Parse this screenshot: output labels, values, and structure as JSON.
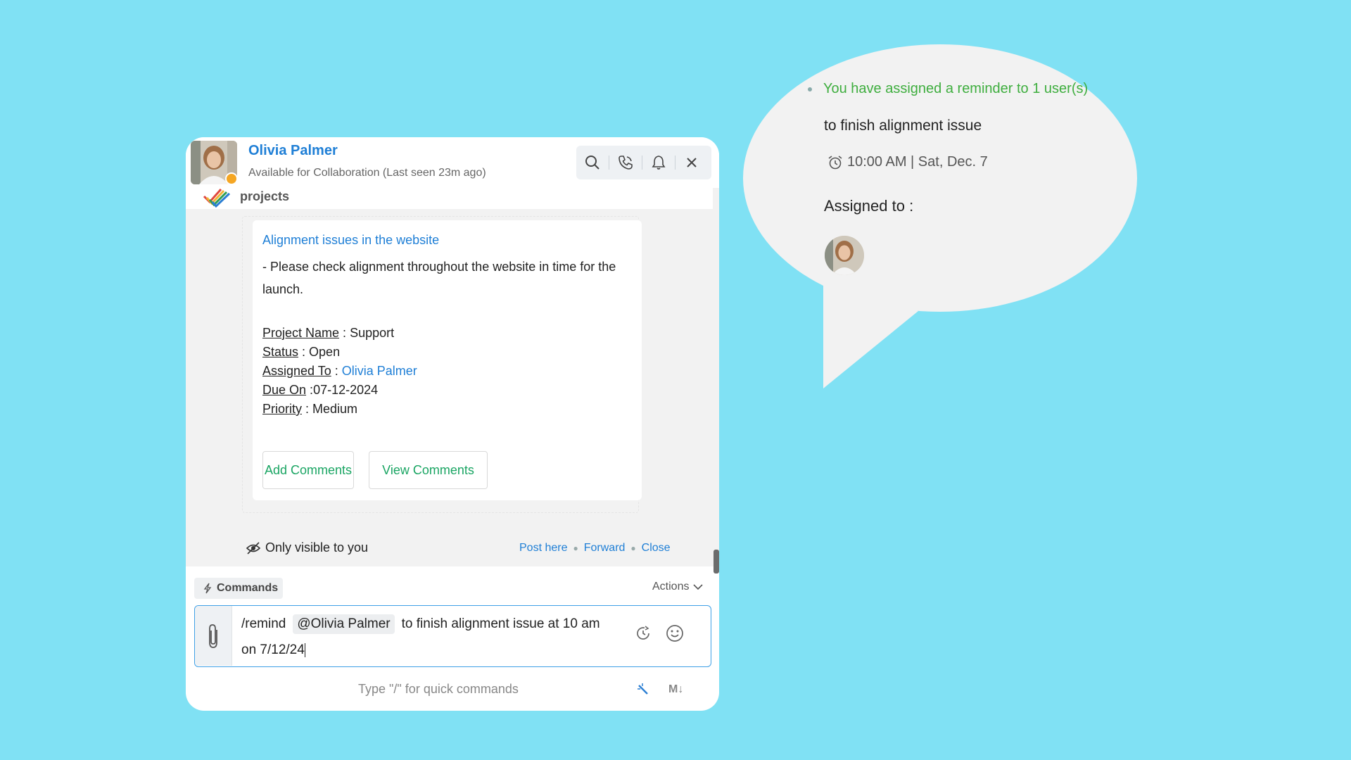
{
  "header": {
    "user_name": "Olivia Palmer",
    "presence": "Available for Collaboration (Last seen 23m ago)",
    "icons": [
      "search-icon",
      "call-icon",
      "bell-icon",
      "close-icon"
    ]
  },
  "integration": {
    "label": "projects"
  },
  "task_card": {
    "title": "Alignment issues in the website",
    "description": "- Please check alignment throughout the website in time for the launch.",
    "fields": [
      {
        "label": "Project Name",
        "separator": " : ",
        "value": "Support"
      },
      {
        "label": "Status",
        "separator": " : ",
        "value": "Open"
      },
      {
        "label": "Assigned To",
        "separator": " : ",
        "value": "Olivia Palmer"
      },
      {
        "label": "Due On",
        "separator": " :",
        "value": "07-12-2024"
      },
      {
        "label": "Priority",
        "separator": " : ",
        "value": "Medium"
      }
    ],
    "buttons": {
      "add_comments": "Add Comments",
      "view_comments": "View Comments"
    }
  },
  "message_footer": {
    "visibility": "Only visible to you",
    "post_here": "Post here",
    "forward": "Forward",
    "close": "Close"
  },
  "composer": {
    "commands_label": "Commands",
    "actions_label": "Actions",
    "command": "/remind",
    "mention": "@Olivia Palmer",
    "text_line1": "to finish alignment issue at 10 am",
    "text_line2": "on 7/12/24",
    "hint": "Type \"/\" for quick commands",
    "markdown_label": "M↓"
  },
  "reminder_bubble": {
    "confirmation": "You have assigned a reminder to 1 user(s)",
    "task": "to finish alignment issue",
    "time": "10:00 AM | Sat, Dec. 7",
    "assigned_to_label": "Assigned to :"
  },
  "colors": {
    "background": "#80e1f4",
    "link_blue": "#1f7fd6",
    "action_green": "#1aa563",
    "confirmation_green": "#3fae3f",
    "presence_dot": "#f5a623"
  }
}
